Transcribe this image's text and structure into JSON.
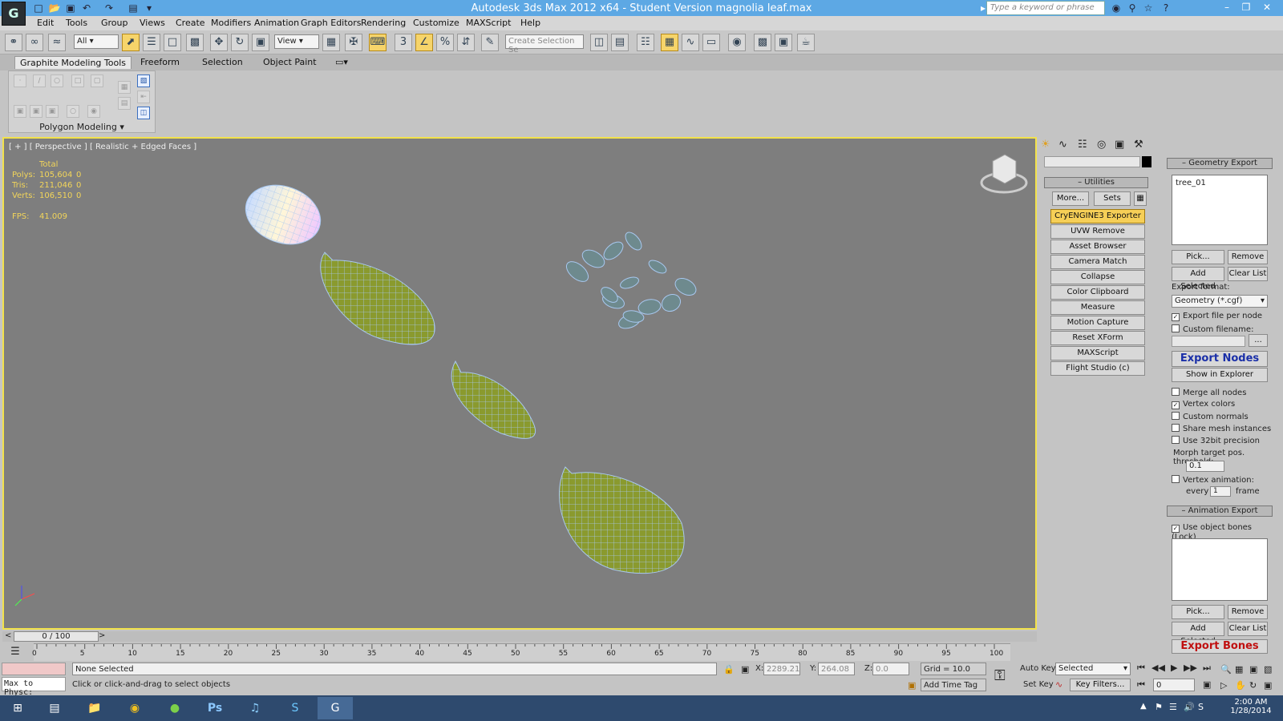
{
  "window": {
    "title": "Autodesk 3ds Max  2012 x64  - Student Version    magnolia leaf.max",
    "search_placeholder": "Type a keyword or phrase"
  },
  "menu": [
    "Edit",
    "Tools",
    "Group",
    "Views",
    "Create",
    "Modifiers",
    "Animation",
    "Graph Editors",
    "Rendering",
    "Customize",
    "MAXScript",
    "Help"
  ],
  "toolbar": {
    "filter_value": "All",
    "coord_value": "View",
    "selection_set_placeholder": "Create Selection Se"
  },
  "ribbon": {
    "tabs": [
      "Graphite Modeling Tools",
      "Freeform",
      "Selection",
      "Object Paint"
    ],
    "panel_label": "Polygon Modeling"
  },
  "viewport": {
    "label": "[ + ] [ Perspective ] [ Realistic + Edged Faces ]",
    "stats": {
      "total_label": "Total",
      "polys_label": "Polys:",
      "polys_value": "105,604",
      "polys_sel": "0",
      "tris_label": "Tris:",
      "tris_value": "211,046",
      "tris_sel": "0",
      "verts_label": "Verts:",
      "verts_value": "106,510",
      "verts_sel": "0",
      "fps_label": "FPS:",
      "fps_value": "41.009"
    }
  },
  "timeline": {
    "frame": "0 / 100",
    "ticks": [
      "0",
      "5",
      "10",
      "15",
      "20",
      "25",
      "30",
      "35",
      "40",
      "45",
      "50",
      "55",
      "60",
      "65",
      "70",
      "75",
      "80",
      "85",
      "90",
      "95",
      "100"
    ]
  },
  "command_panel": {
    "utilities_title": "Utilities",
    "more_label": "More...",
    "sets_label": "Sets",
    "utilities": [
      "CryENGINE3 Exporter",
      "UVW Remove",
      "Asset Browser",
      "Camera Match",
      "Collapse",
      "Color Clipboard",
      "Measure",
      "Motion Capture",
      "Reset XForm",
      "MAXScript",
      "Flight Studio (c)"
    ]
  },
  "geometry_export": {
    "title": "Geometry Export",
    "list_item": "tree_01",
    "pick": "Pick...",
    "remove": "Remove",
    "add_selected": "Add Selected",
    "clear_list": "Clear List",
    "format_label": "Export format:",
    "format_value": "Geometry (*.cgf)",
    "export_file_per_node": "Export file per node",
    "custom_filename": "Custom filename:",
    "browse": "...",
    "export_nodes": "Export Nodes",
    "show_in_explorer": "Show in Explorer",
    "merge_all_nodes": "Merge all nodes",
    "vertex_colors": "Vertex colors",
    "custom_normals": "Custom normals",
    "share_mesh": "Share mesh instances",
    "use_32bit": "Use 32bit precision",
    "morph_label": "Morph target pos. threshold:",
    "morph_value": "0.1",
    "vertex_animation": "Vertex animation:",
    "every_label": "every",
    "every_value": "1",
    "frame_label": "frame"
  },
  "animation_export": {
    "title": "Animation Export",
    "use_bones": "Use object bones (Lock)",
    "pick": "Pick...",
    "remove": "Remove",
    "add_selected": "Add Selected",
    "clear_list": "Clear List",
    "export_bones": "Export Bones"
  },
  "status": {
    "maxscript_label": "Max to Physc:",
    "selection": "None Selected",
    "prompt": "Click or click-and-drag to select objects",
    "x_label": "X:",
    "x_value": "2289.21",
    "y_label": "Y:",
    "y_value": "264.08",
    "z_label": "Z:",
    "z_value": "0.0",
    "grid": "Grid = 10.0",
    "add_time_tag": "Add Time Tag",
    "auto_key": "Auto Key",
    "set_key": "Set Key",
    "selected_value": "Selected",
    "key_filters": "Key Filters...",
    "frame_value": "0"
  },
  "taskbar": {
    "time": "2:00 AM",
    "date": "1/28/2014"
  }
}
